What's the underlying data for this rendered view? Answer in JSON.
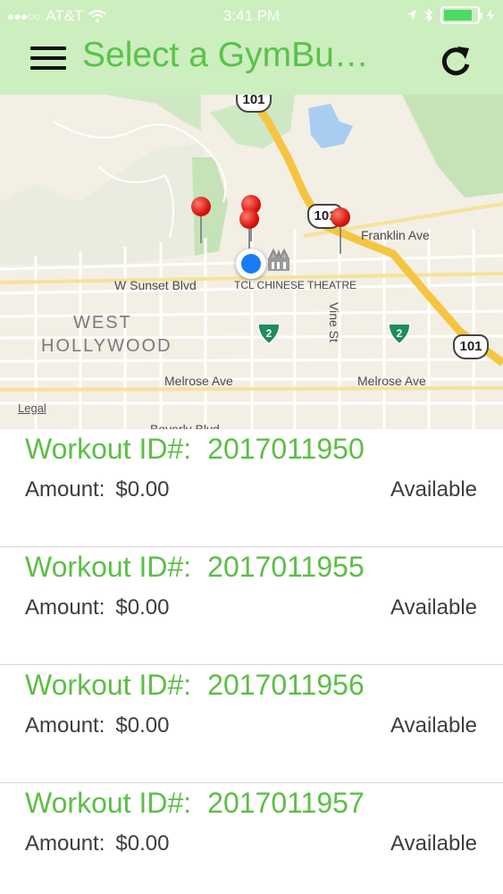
{
  "status_bar": {
    "carrier": "AT&T",
    "time": "3:41 PM"
  },
  "header": {
    "title": "Select a GymBu…"
  },
  "map": {
    "labels": {
      "sunset": "W Sunset Blvd",
      "poi": "TCL CHINESE THEATRE",
      "west": "WEST",
      "hollywood": "HOLLYWOOD",
      "melrose_left": "Melrose Ave",
      "melrose_right": "Melrose Ave",
      "franklin": "Franklin Ave",
      "vine": "Vine St",
      "beverly": "Beverly Blvd",
      "legal": "Legal"
    },
    "shields": {
      "hwy101_top": "101",
      "hwy101_mid": "101",
      "hwy101_right": "101",
      "hwy2_left": "2",
      "hwy2_right": "2"
    }
  },
  "workouts": {
    "id_label": "Workout ID#:",
    "amount_label": "Amount:",
    "items": [
      {
        "id": "2017011950",
        "amount": "$0.00",
        "status": "Available"
      },
      {
        "id": "2017011955",
        "amount": "$0.00",
        "status": "Available"
      },
      {
        "id": "2017011956",
        "amount": "$0.00",
        "status": "Available"
      },
      {
        "id": "2017011957",
        "amount": "$0.00",
        "status": "Available"
      }
    ]
  },
  "colors": {
    "header_bg": "#cdeebf",
    "accent_green": "#5cbf46",
    "pin_red": "#d8140c",
    "location_blue": "#1a7cf5"
  },
  "icons": [
    "menu-icon",
    "refresh-icon",
    "wifi-icon",
    "location-arrow-icon",
    "bluetooth-icon",
    "battery-icon"
  ]
}
